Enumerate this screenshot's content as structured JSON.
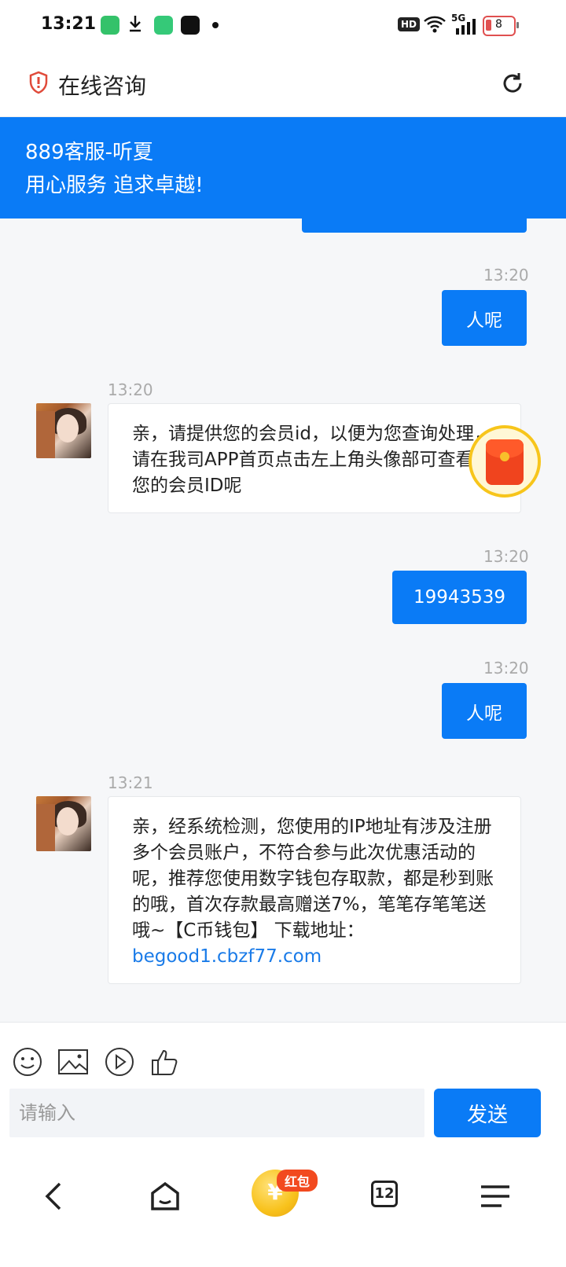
{
  "status_bar": {
    "time": "13:21",
    "hd": "HD",
    "network": "5G",
    "battery": "8"
  },
  "header": {
    "title": "在线咨询"
  },
  "banner": {
    "agent_name": "889客服-听夏",
    "slogan": "用心服务 追求卓越!"
  },
  "messages": [
    {
      "side": "out",
      "time": "13:20",
      "text": "人呢"
    },
    {
      "side": "in",
      "time": "13:20",
      "text": "亲，请提供您的会员id，以便为您查询处理，请在我司APP首页点击左上角头像部可查看到您的会员ID呢"
    },
    {
      "side": "out",
      "time": "13:20",
      "text": "19943539"
    },
    {
      "side": "out",
      "time": "13:20",
      "text": "人呢"
    },
    {
      "side": "in",
      "time": "13:21",
      "text_before_link": "亲，经系统检测，您使用的IP地址有涉及注册多个会员账户，不符合参与此次优惠活动的呢，推荐您使用数字钱包存取款，都是秒到账的哦，首次存款最高赠送7%，笔笔存笔笔送哦~【C币钱包】 下载地址：",
      "link": "begood1.cbzf77.com"
    }
  ],
  "composer": {
    "placeholder": "请输入",
    "send_label": "发送"
  },
  "bottom_nav": {
    "red_packet_badge": "红包",
    "coin_symbol": "¥",
    "tab_count": "12"
  },
  "colors": {
    "primary": "#0a7bf6",
    "link": "#1a7be8",
    "badge": "#f24a1f"
  }
}
